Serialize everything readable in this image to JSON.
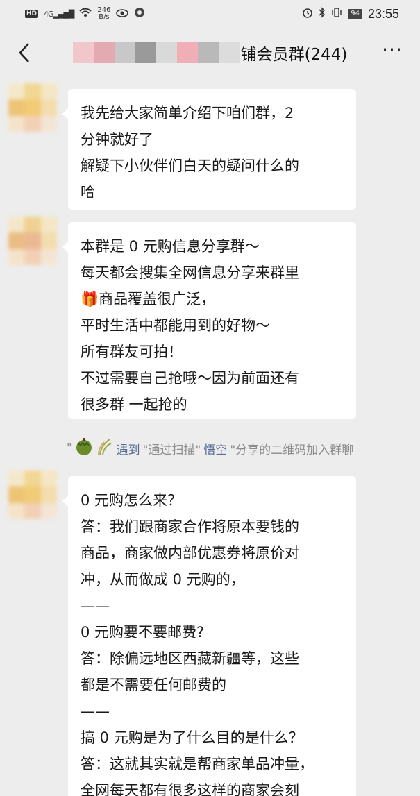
{
  "status_bar": {
    "hd": "HD",
    "net_type": "4G",
    "speed_value": "246",
    "speed_unit": "B/s",
    "battery": "94",
    "time": "23:55"
  },
  "header": {
    "title": "铺会员群(244)",
    "back_icon": "chevron-left-icon",
    "more_icon": "ellipsis-icon"
  },
  "messages": [
    {
      "lines": [
        "我先给大家简单介绍下咱们群，2",
        "分钟就好了",
        "解疑下小伙伴们白天的疑问什么的",
        "哈"
      ]
    },
    {
      "lines": [
        "本群是 0 元购信息分享群～",
        "每天都会搜集全网信息分享来群里",
        "商品覆盖很广泛，",
        "平时生活中都能用到的好物～",
        "所有群友可拍！",
        "不过需要自己抢哦～因为前面还有",
        "很多群 一起抢的"
      ],
      "emoji": "🎁"
    },
    {
      "lines": [
        "0 元购怎么来？",
        "答：我们跟商家合作将原本要钱的",
        "商品，商家做内部优惠券将原价对",
        "冲，从而做成 0 元购的，",
        "——",
        "0 元购要不要邮费?",
        "答：除偏远地区西藏新疆等，这些",
        "都是不需要任何邮费的",
        "——",
        "搞 0 元购是为了什么目的是什么？",
        "答：这就其实就是帮商家单品冲量，",
        "全网每天都有很多这样的商家会刻"
      ]
    }
  ],
  "system_notice": {
    "quote_open": "\"",
    "inviter": "遇到",
    "middle": "\"通过扫描\"",
    "sharer": "悟空",
    "tail": "\"分享的二维码加入群聊",
    "icons": [
      "durian-icon",
      "plant-icon"
    ]
  },
  "colors": {
    "background": "#ededed",
    "bubble": "#ffffff",
    "link": "#576b95",
    "system_text": "#8c8c8c"
  }
}
